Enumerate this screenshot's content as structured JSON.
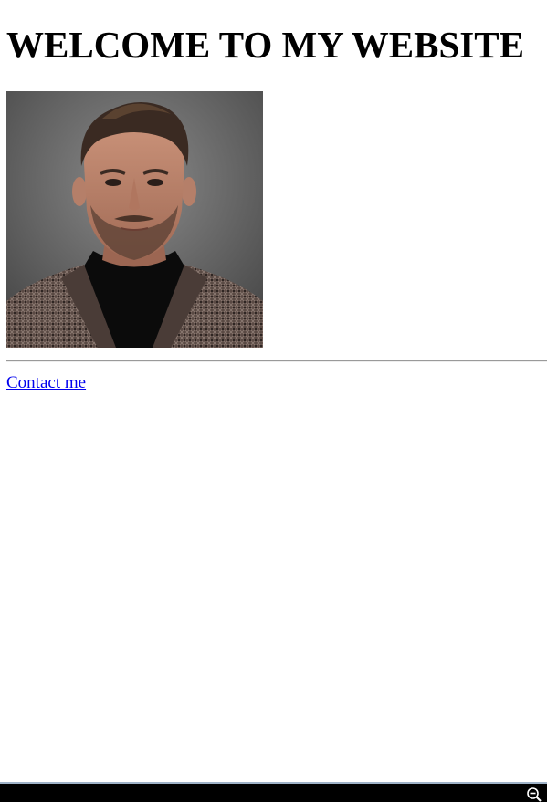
{
  "page": {
    "title": "WELCOME TO MY WEBSITE"
  },
  "main": {
    "portrait_icon": "person-portrait-image",
    "contact_link_text": "Contact me"
  },
  "status_bar": {
    "zoom_icon": "zoom-out-icon"
  },
  "colors": {
    "link": "#0000ee",
    "bar": "#000000"
  }
}
